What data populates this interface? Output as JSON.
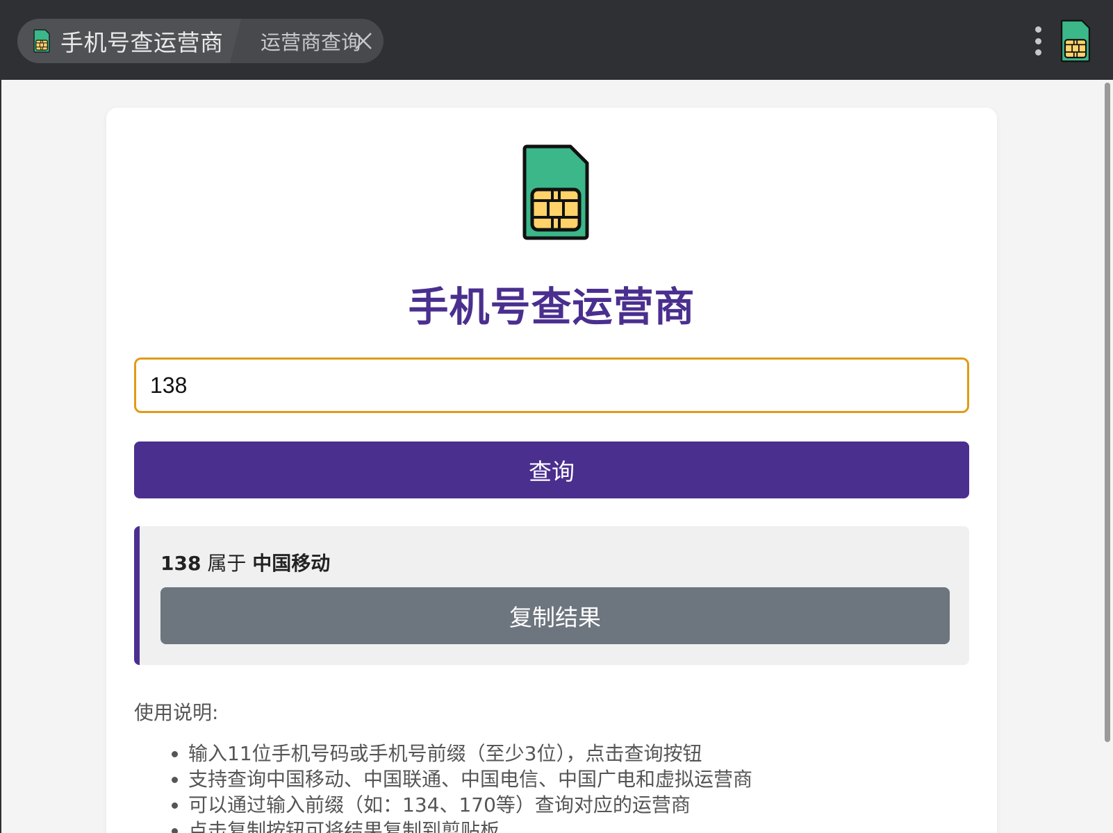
{
  "window": {
    "app_tab_title": "手机号查运营商",
    "page_tab_title": "运营商查询",
    "icons": {
      "app": "sim-card-icon",
      "close": "close-icon",
      "menu": "more-vertical-icon"
    }
  },
  "main": {
    "title": "手机号查运营商",
    "input": {
      "value": "138",
      "placeholder": ""
    },
    "query_button_label": "查询",
    "result": {
      "prefix": "138",
      "middle": "属于",
      "carrier": "中国移动",
      "copy_button_label": "复制结果"
    },
    "instructions": {
      "heading": "使用说明:",
      "items": [
        "输入11位手机号码或手机号前缀（至少3位），点击查询按钮",
        "支持查询中国移动、中国联通、中国电信、中国广电和虚拟运营商",
        "可以通过输入前缀（如：134、170等）查询对应的运营商",
        "点击复制按钮可将结果复制到剪贴板"
      ]
    }
  },
  "colors": {
    "accent": "#4a2f8f",
    "input_border": "#e09b16",
    "copy_button": "#6d757e",
    "sim_green": "#3bb78a",
    "sim_chip": "#ffd36a"
  }
}
